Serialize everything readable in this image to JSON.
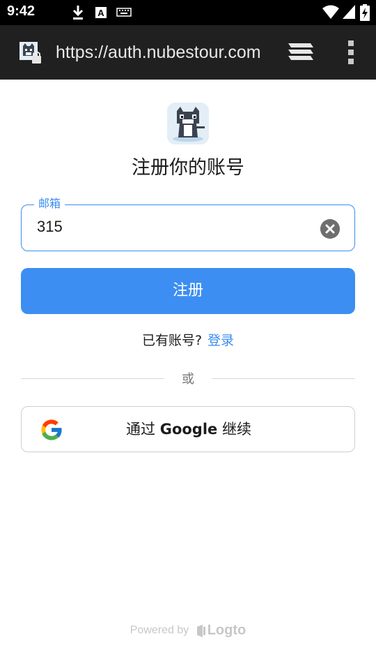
{
  "status_bar": {
    "time": "9:42",
    "icons": [
      "download-icon",
      "font-a-icon",
      "keyboard-icon",
      "wifi-icon",
      "signal-icon",
      "battery-charging-icon"
    ]
  },
  "browser": {
    "url": "https://auth.nubestour.com",
    "icons": [
      "site-favicon",
      "lock-icon",
      "tabs-icon",
      "more-vert-icon"
    ]
  },
  "page": {
    "title": "注册你的账号",
    "email_label": "邮箱",
    "email_value": "315",
    "register_label": "注册",
    "have_account": "已有账号?",
    "login_link": "登录",
    "or": "或",
    "google_prefix": "通过 ",
    "google_brand": "Google",
    "google_suffix": " 继续",
    "powered_by": "Powered by",
    "powered_brand": "Logto"
  },
  "colors": {
    "accent": "#3a8cf0",
    "button": "#3d8ef2",
    "toolbar": "#202020"
  }
}
